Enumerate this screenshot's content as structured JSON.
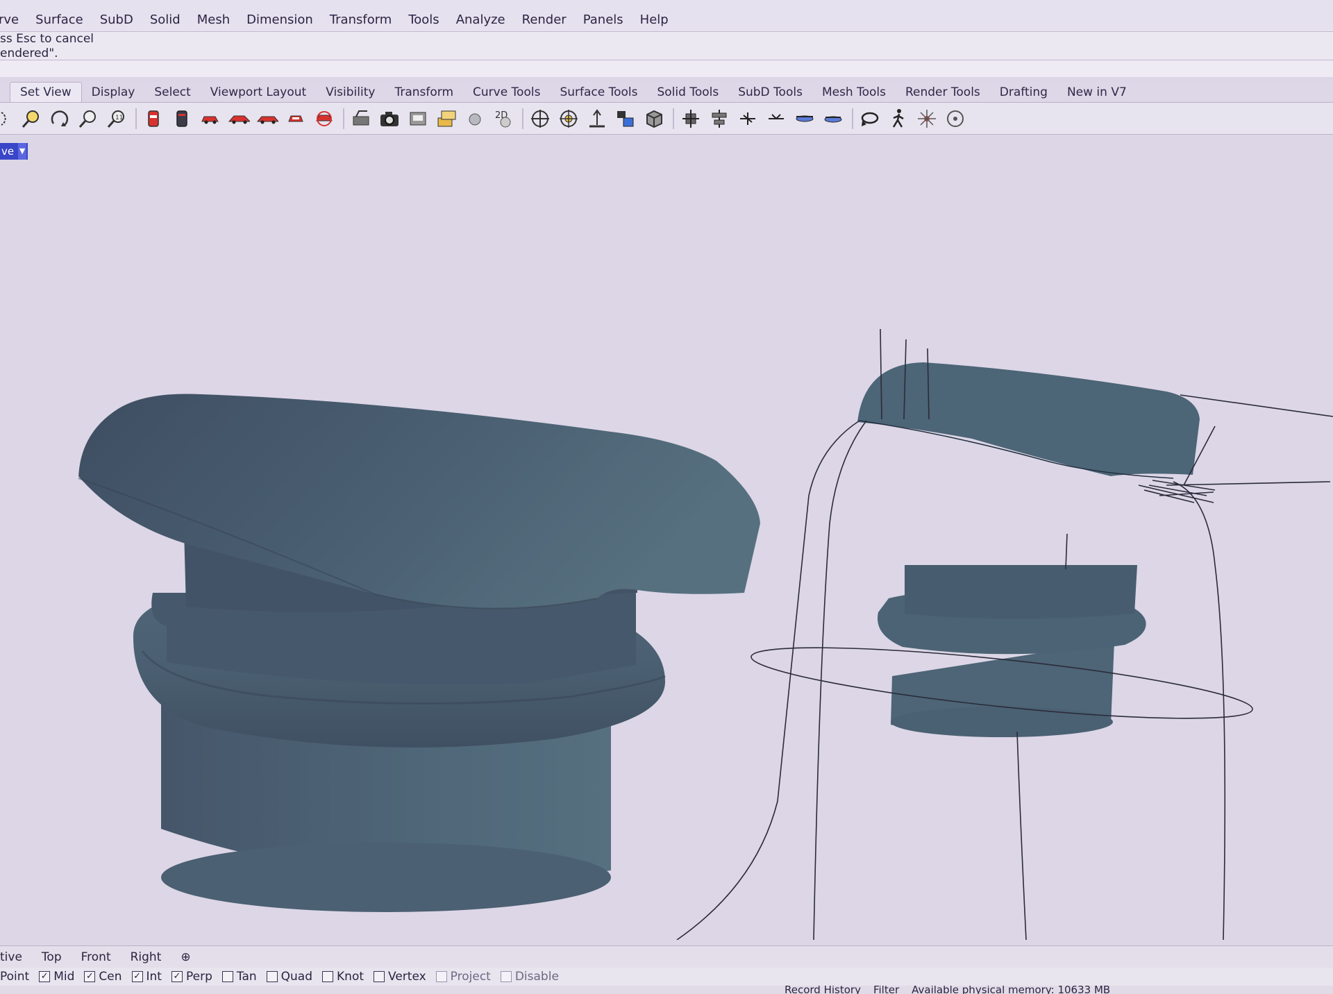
{
  "menubar": {
    "items": [
      "rve",
      "Surface",
      "SubD",
      "Solid",
      "Mesh",
      "Dimension",
      "Transform",
      "Tools",
      "Analyze",
      "Render",
      "Panels",
      "Help"
    ]
  },
  "command_history": {
    "line1": "ss Esc to cancel",
    "line2": "endered\"."
  },
  "tabs": [
    "Set View",
    "Display",
    "Select",
    "Viewport Layout",
    "Visibility",
    "Transform",
    "Curve Tools",
    "Surface Tools",
    "Solid Tools",
    "SubD Tools",
    "Mesh Tools",
    "Render Tools",
    "Drafting",
    "New in V7"
  ],
  "toolbar_icons": [
    "zoom-extents-icon",
    "zoom-window-icon",
    "rotate-view-icon",
    "zoom-icon",
    "zoom-selected-icon",
    "cylinder-red-icon",
    "cylinder-dark-icon",
    "car-red-icon",
    "car-side-icon",
    "car-front-icon",
    "car-back-icon",
    "car-rotate-icon",
    "camera-target-icon",
    "camera-icon",
    "named-view-icon",
    "named-cplane-icon",
    "sphere-icon",
    "view-2d-icon",
    "crosshair-icon",
    "target-icon",
    "cplane-icon",
    "layer-icon",
    "box-icon",
    "gumball-icon",
    "align-icon",
    "arrow-icon",
    "arrow-split-icon",
    "plane-icon",
    "plane-flat-icon",
    "undo-view-icon",
    "walk-icon",
    "sun-icon",
    "compass-icon"
  ],
  "viewport": {
    "label": "ve",
    "tabs": [
      "tive",
      "Top",
      "Front",
      "Right"
    ]
  },
  "osnaps": [
    {
      "label": "Point",
      "checked": null
    },
    {
      "label": "Mid",
      "checked": true
    },
    {
      "label": "Cen",
      "checked": true
    },
    {
      "label": "Int",
      "checked": true
    },
    {
      "label": "Perp",
      "checked": true
    },
    {
      "label": "Tan",
      "checked": false
    },
    {
      "label": "Quad",
      "checked": false
    },
    {
      "label": "Knot",
      "checked": false
    },
    {
      "label": "Vertex",
      "checked": false
    },
    {
      "label": "Project",
      "checked": false,
      "dim": true
    },
    {
      "label": "Disable",
      "checked": false,
      "dim": true
    }
  ],
  "statusbar": {
    "items": [
      "Record History",
      "Filter",
      "Available physical memory: 10633 MB"
    ]
  },
  "colors": {
    "model": "#4f6675",
    "background": "#dcd6e6",
    "viewport_label_bg": "#3a46c8"
  }
}
